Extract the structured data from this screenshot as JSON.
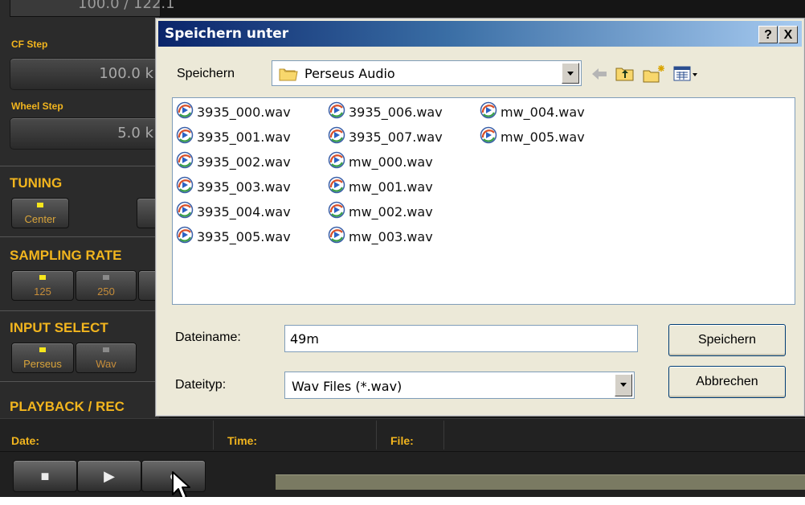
{
  "app": {
    "top_display": "100.0 / 122.1",
    "cf_step_label": "CF Step",
    "cf_step_value": "100.0 k",
    "wheel_step_label": "Wheel Step",
    "wheel_step_value": "5.0 k",
    "tuning_label": "TUNING",
    "tuning_buttons": [
      "Center"
    ],
    "sampling_rate_label": "SAMPLING RATE",
    "sampling_buttons": [
      "125",
      "250"
    ],
    "input_select_label": "INPUT SELECT",
    "input_buttons": [
      "Perseus",
      "Wav"
    ],
    "playback_label": "PLAYBACK / REC",
    "date_label": "Date:",
    "time_label": "Time:",
    "file_label": "File:"
  },
  "dialog": {
    "title": "Speichern unter",
    "help_button": "?",
    "close_button": "X",
    "save_in_label": "Speichern",
    "save_in_value": "Perseus Audio",
    "files": [
      "3935_000.wav",
      "3935_001.wav",
      "3935_002.wav",
      "3935_003.wav",
      "3935_004.wav",
      "3935_005.wav",
      "3935_006.wav",
      "3935_007.wav",
      "mw_000.wav",
      "mw_001.wav",
      "mw_002.wav",
      "mw_003.wav",
      "mw_004.wav",
      "mw_005.wav"
    ],
    "filename_label": "Dateiname:",
    "filename_value": "49m",
    "filetype_label": "Dateityp:",
    "filetype_value": "Wav Files (*.wav)",
    "save_button": "Speichern",
    "cancel_button": "Abbrechen"
  }
}
